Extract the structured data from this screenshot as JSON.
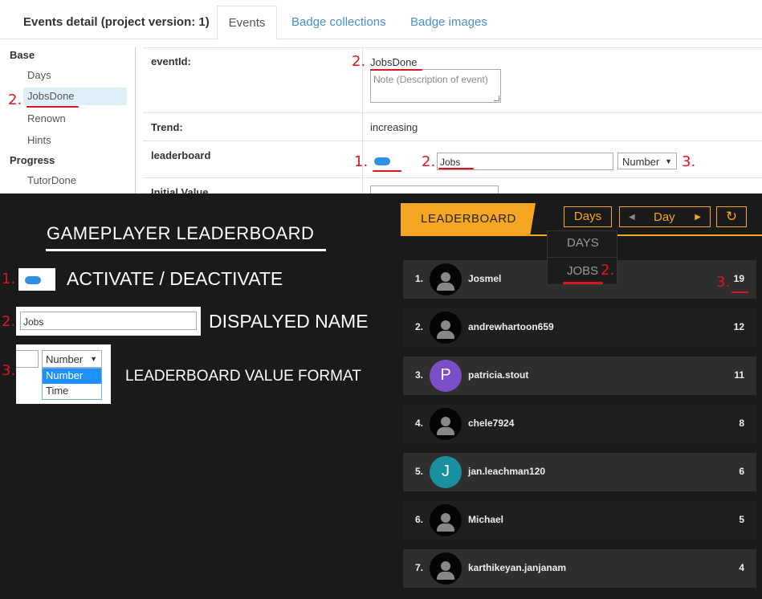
{
  "admin": {
    "page_title": "Events detail (project version: 1)",
    "tabs": [
      {
        "label": "Events"
      },
      {
        "label": "Badge collections"
      },
      {
        "label": "Badge images"
      }
    ],
    "sidebar": {
      "sections": [
        {
          "label": "Base",
          "items": [
            "Days",
            "JobsDone",
            "Renown",
            "Hints"
          ]
        },
        {
          "label": "Progress",
          "items": [
            "TutorDone"
          ]
        }
      ],
      "selected_item": "JobsDone"
    },
    "form": {
      "event_id_label": "eventId:",
      "event_id_value": "JobsDone",
      "note_placeholder": "Note (Description of event)",
      "trend_label": "Trend:",
      "trend_value": "increasing",
      "leaderboard_label": "leaderboard",
      "leaderboard_name": "Jobs",
      "format_value": "Number",
      "initial_value_label": "Initial Value"
    }
  },
  "guide": {
    "title": "GAMEPLAYER LEADERBOARD",
    "activate_label": "ACTIVATE / DEACTIVATE",
    "displayed_name_label": "DISPALYED NAME",
    "displayed_name_value": "Jobs",
    "format_label": "LEADERBOARD VALUE FORMAT",
    "format_selected": "Number",
    "format_options": [
      "Number",
      "Time"
    ]
  },
  "markers": {
    "one": "1.",
    "two": "2.",
    "three": "3."
  },
  "leaderboard": {
    "tab_label": "LEADERBOARD",
    "period_selector": "Days",
    "period_label": "Day",
    "prev_icon": "◀",
    "next_icon": "▶",
    "refresh_icon": "↻",
    "dropdown_items": [
      "DAYS",
      "JOBS"
    ],
    "rows": [
      {
        "rank": "1.",
        "name": "Josmel",
        "score": "19",
        "avatar": "silhouette"
      },
      {
        "rank": "2.",
        "name": "andrewhartoon659",
        "score": "12",
        "avatar": "silhouette"
      },
      {
        "rank": "3.",
        "name": "patricia.stout",
        "score": "11",
        "avatar": "letter",
        "letter": "P",
        "color": "#7b4fc9"
      },
      {
        "rank": "4.",
        "name": "chele7924",
        "score": "8",
        "avatar": "silhouette"
      },
      {
        "rank": "5.",
        "name": "jan.leachman120",
        "score": "6",
        "avatar": "letter",
        "letter": "J",
        "color": "#1a8fa0"
      },
      {
        "rank": "6.",
        "name": "Michael",
        "score": "5",
        "avatar": "silhouette"
      },
      {
        "rank": "7.",
        "name": "karthikeyan.janjanam",
        "score": "4",
        "avatar": "silhouette"
      }
    ]
  },
  "colors": {
    "accent": "#f5a623",
    "annotation": "#e0141e",
    "toggle": "#2f8fe0"
  }
}
